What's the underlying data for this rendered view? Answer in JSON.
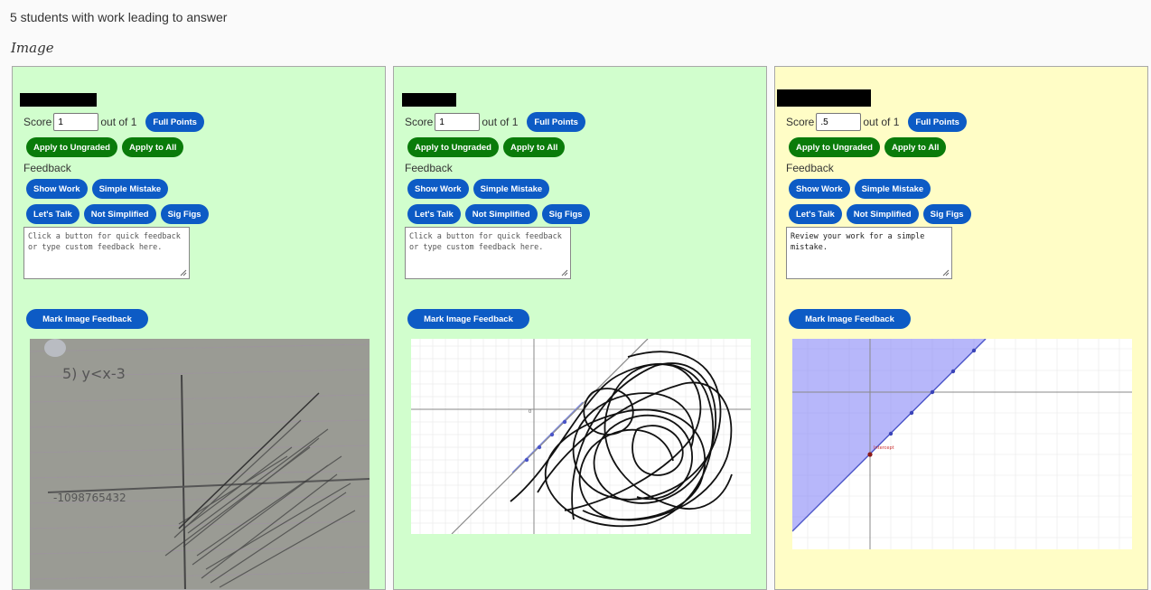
{
  "header": {
    "title": "5 students with work leading to answer",
    "subtitle": "Image"
  },
  "cards": [
    {
      "score": "1",
      "out_of": "out of 1",
      "score_label": "Score",
      "feedback_text": "",
      "feedback_placeholder": "Click a button for quick feedback or type custom feedback here.",
      "background": "#d1fecd"
    },
    {
      "score": "1",
      "out_of": "out of 1",
      "score_label": "Score",
      "feedback_text": "",
      "feedback_placeholder": "Click a button for quick feedback or type custom feedback here.",
      "background": "#d1fecd"
    },
    {
      "score": ".5",
      "out_of": "out of 1",
      "score_label": "Score",
      "feedback_text": "Review your work for a simple mistake.",
      "feedback_placeholder": "Click a button for quick feedback or type custom feedback here.",
      "background": "#fffdc6"
    }
  ],
  "labels": {
    "full_points": "Full Points",
    "apply_ungraded": "Apply to Ungraded",
    "apply_all": "Apply to All",
    "feedback": "Feedback",
    "show_work": "Show Work",
    "simple_mistake": "Simple Mistake",
    "lets_talk": "Let's Talk",
    "not_simplified": "Not Simplified",
    "sig_figs": "Sig Figs",
    "mark_image": "Mark Image Feedback"
  },
  "images": {
    "photo_text_eq": "5) y<x-3",
    "photo_text_axis": "-1098765432",
    "graph_label": "Intercept"
  },
  "colors": {
    "blue_button": "#0d5bc5",
    "green_button": "#0a7b0a",
    "green_card": "#d1fecd",
    "yellow_card": "#fffdc6"
  }
}
